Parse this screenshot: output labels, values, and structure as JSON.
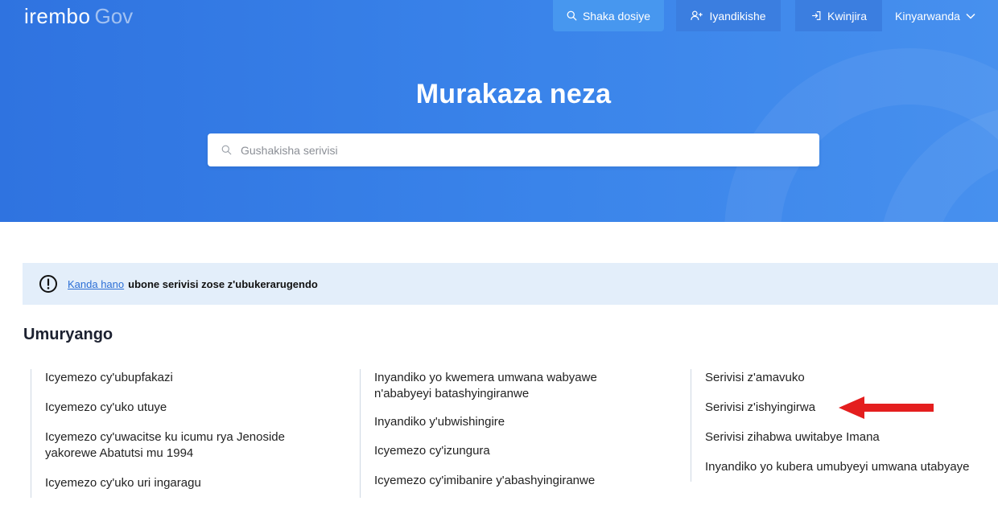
{
  "header": {
    "logo_brand": "irembo",
    "logo_suffix": "Gov",
    "nav": {
      "search_label": "Shaka dosiye",
      "register_label": "Iyandikishe",
      "login_label": "Kwinjira",
      "language_label": "Kinyarwanda"
    }
  },
  "hero": {
    "title": "Murakaza neza",
    "search_placeholder": "Gushakisha serivisi"
  },
  "notice": {
    "link_text": "Kanda hano",
    "text": "ubone serivisi zose z'ubukerarugendo"
  },
  "category": {
    "title": "Umuryango",
    "columns": [
      [
        "Icyemezo cy'ubupfakazi",
        "Icyemezo cy'uko utuye",
        "Icyemezo cy'uwacitse ku icumu rya Jenoside yakorewe Abatutsi mu 1994",
        "Icyemezo cy'uko uri ingaragu"
      ],
      [
        "Inyandiko yo kwemera umwana wabyawe n'ababyeyi batashyingiranwe",
        "Inyandiko y'ubwishingire",
        "Icyemezo cy'izungura",
        "Icyemezo cy'imibanire y'abashyingiranwe"
      ],
      [
        "Serivisi z'amavuko",
        "Serivisi z'ishyingirwa",
        "Serivisi zihabwa uwitabye Imana",
        "Inyandiko yo kubera umubyeyi umwana utabyaye"
      ]
    ]
  },
  "colors": {
    "hero_start": "#2f73e0",
    "hero_end": "#4790ee",
    "notice_bg": "#e3eefa",
    "link": "#2c6fd6",
    "arrow": "#e41e1e"
  }
}
